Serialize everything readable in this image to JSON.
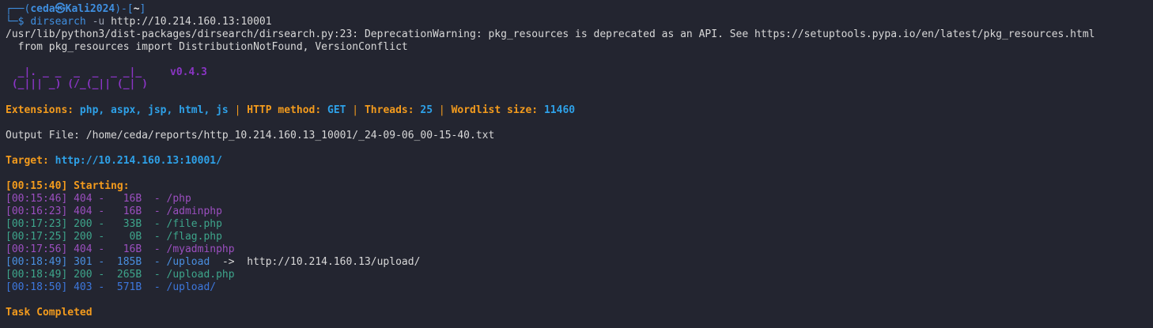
{
  "prompt": {
    "frame_top": "┌──(",
    "user_host": "ceda㉿Kali2024",
    "mid": ")-[",
    "dir": "~",
    "close": "]",
    "frame_bottom": "└─$ ",
    "cmd_name": "dirsearch",
    "cmd_flag": "-u",
    "cmd_arg": "http://10.214.160.13:10001"
  },
  "warning": {
    "line1": "/usr/lib/python3/dist-packages/dirsearch/dirsearch.py:23: DeprecationWarning: pkg_resources is deprecated as an API. See https://setuptools.pypa.io/en/latest/pkg_resources.html",
    "line2": "  from pkg_resources import DistributionNotFound, VersionConflict"
  },
  "banner": {
    "art_line1": "  _|. _ _  _  _  _ _|_",
    "art_line2": " (_||| _) (/_(_|| (_| )",
    "version": "v0.4.3"
  },
  "config": {
    "ext_label": "Extensions: ",
    "ext_value": "php, aspx, jsp, html, js",
    "sep": " | ",
    "method_label": "HTTP method: ",
    "method_value": "GET",
    "threads_label": "Threads: ",
    "threads_value": "25",
    "wordlist_label": "Wordlist size: ",
    "wordlist_value": "11460"
  },
  "output_file": "Output File: /home/ceda/reports/http_10.214.160.13_10001/_24-09-06_00-15-40.txt",
  "target": {
    "label": "Target: ",
    "value": "http://10.214.160.13:10001/"
  },
  "starting": "[00:15:40] Starting: ",
  "results": [
    {
      "text": "[00:15:46] 404 -   16B  - /php",
      "status": "404"
    },
    {
      "text": "[00:16:23] 404 -   16B  - /adminphp",
      "status": "404"
    },
    {
      "text": "[00:17:23] 200 -   33B  - /file.php",
      "status": "200"
    },
    {
      "text": "[00:17:25] 200 -    0B  - /flag.php",
      "status": "200"
    },
    {
      "text": "[00:17:56] 404 -   16B  - /myadminphp",
      "status": "404"
    },
    {
      "text": "[00:18:49] 301 -  185B  - /upload  ",
      "status": "301",
      "redirect": "->  http://10.214.160.13/upload/"
    },
    {
      "text": "[00:18:49] 200 -  265B  - /upload.php",
      "status": "200"
    },
    {
      "text": "[00:18:50] 403 -  571B  - /upload/",
      "status": "403"
    }
  ],
  "completed": "Task Completed"
}
